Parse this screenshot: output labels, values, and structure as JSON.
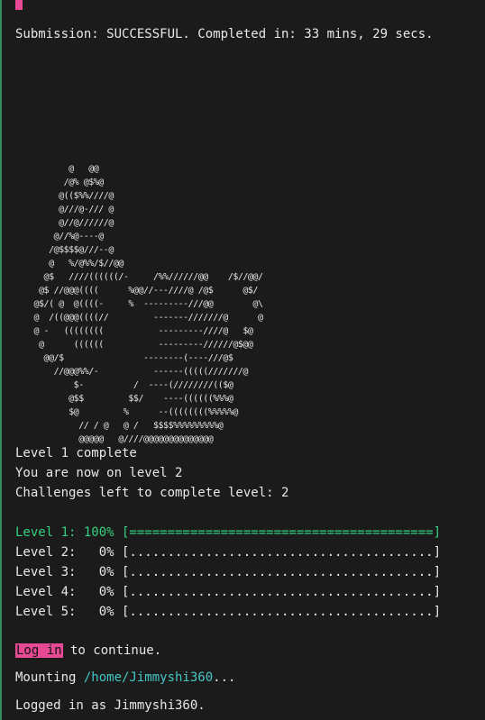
{
  "top_strip_text": "´ ´ ´ ´ ´ ´ ´ ´ ´ ´ ´ ´",
  "submission": "Submission: SUCCESSFUL. Completed in: 33 mins, 29 secs.",
  "ascii_art": "        @   @@\n       /@% @$%@\n      @(($%%////@\n      @///@-/// @\n      @//@//////@\n     @//%@----@\n    /@$$$$@///--@\n    @   %/@%%/$//@@\n   @$   ////((((((/-     /%%//////@@    /$//@@/\n  @$ //@@@((((      %@@//---////@ /@$      @$/\n @$/( @  @((((-     %  ---------///@@        @\\\n @  /((@@@((((//         -------///////@      @\n @ -   ((((((((           ---------////@   $@\n  @      ((((((           ---------//////@$@@\n   @@/$                --------(----///@$\n     //@@@%%/-           ------(((((///////@\n         $-          /  ----(////////(($@\n        @$$         $$/    ----((((((%%%@\n        $@         %      --((((((((%%%%%@\n          // / @   @ /   $$$$%%%%%%%%%@\n          @@@@@   @////@@@@@@@@@@@@@@",
  "level_complete": "Level 1 complete",
  "now_on": "You are now on level 2",
  "challenges": "Challenges left to complete level: 2",
  "progress": [
    {
      "text": "Level 1: 100% [========================================]",
      "percent": 100
    },
    {
      "text": "Level 2:   0% [........................................]",
      "percent": 0
    },
    {
      "text": "Level 3:   0% [........................................]",
      "percent": 0
    },
    {
      "text": "Level 4:   0% [........................................]",
      "percent": 0
    },
    {
      "text": "Level 5:   0% [........................................]",
      "percent": 0
    }
  ],
  "login": {
    "button_label": "Log in",
    "suffix": " to continue."
  },
  "mounting": {
    "prefix": "Mounting ",
    "path": "/home/Jimmyshi360",
    "suffix": "..."
  },
  "logged_in": "Logged in as Jimmyshi360.",
  "colors": {
    "background": "#1b1b1b",
    "text": "#e8e8e8",
    "success_green": "#35d07f",
    "accent_pink": "#e64a94",
    "path_cyan": "#45c6c4"
  }
}
